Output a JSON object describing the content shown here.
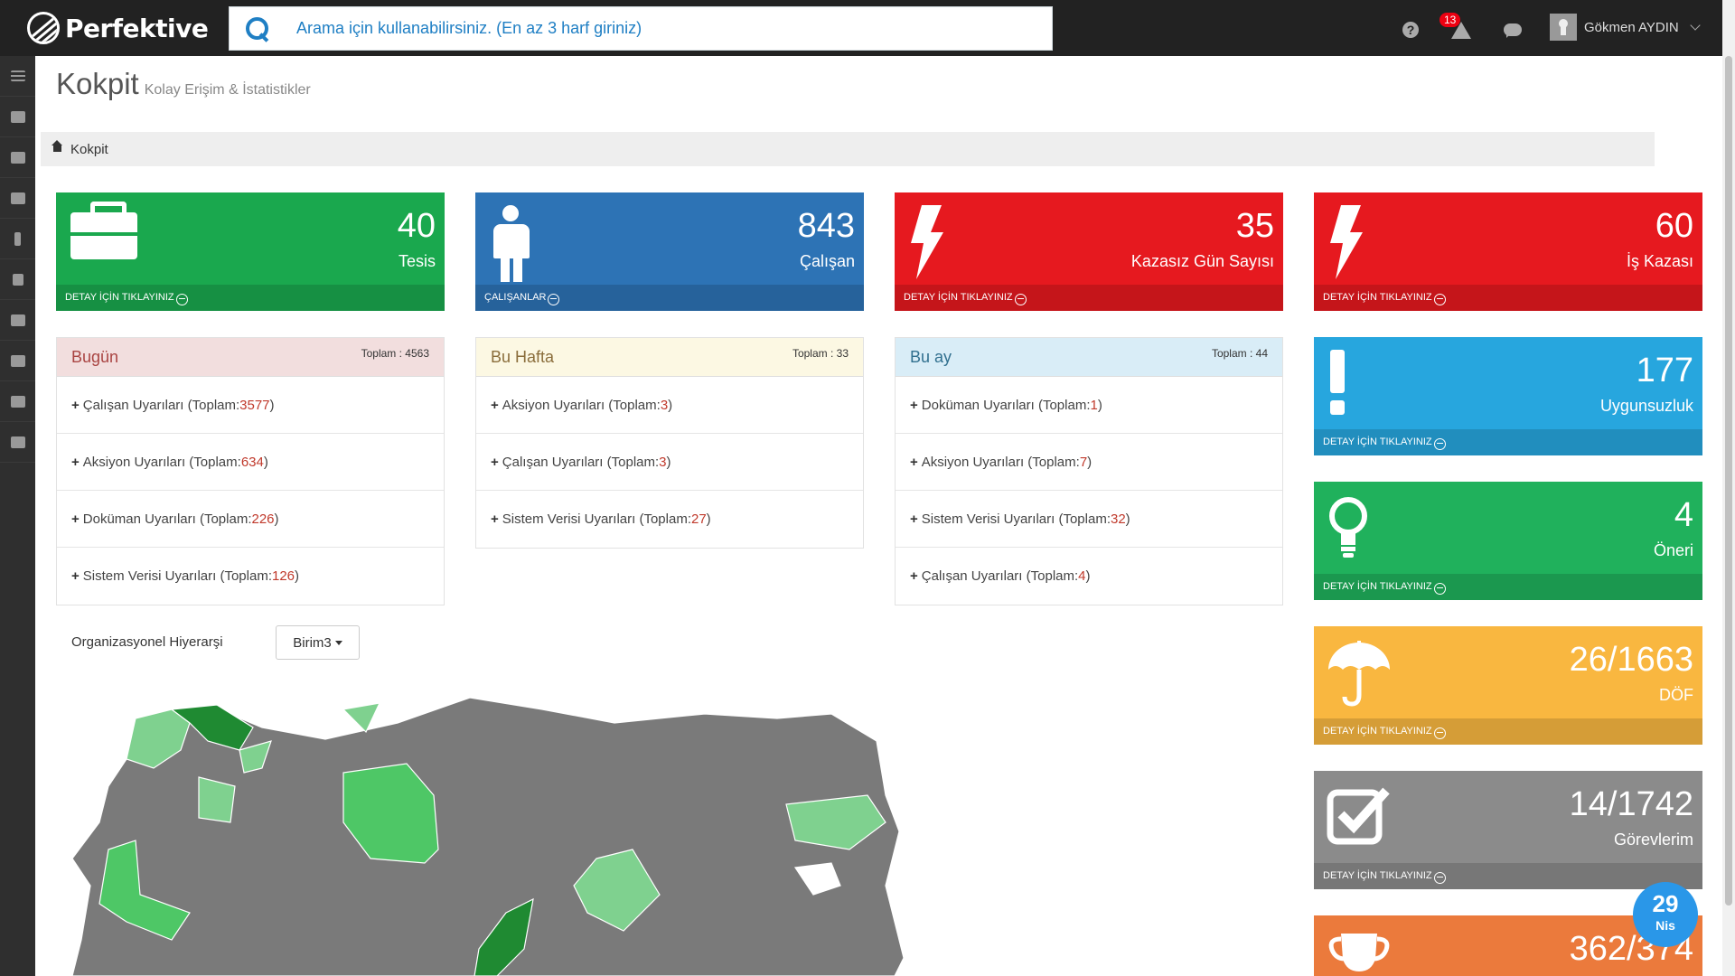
{
  "app": {
    "logo_text": "Perfektive"
  },
  "search": {
    "placeholder": "Arama için kullanabilirsiniz. (En az 3 harf giriniz)"
  },
  "topbar": {
    "alert_count": "13",
    "user_name": "Gökmen AYDIN"
  },
  "page": {
    "title": "Kokpit",
    "subtitle": "Kolay Erişim & İstatistikler",
    "breadcrumb": "Kokpit"
  },
  "stats": [
    {
      "value": "40",
      "label": "Tesis",
      "footer": "DETAY İÇİN TIKLAYINIZ",
      "icon": "briefcase-icon",
      "color": "#1aa84e"
    },
    {
      "value": "843",
      "label": "Çalışan",
      "footer": "ÇALIŞANLAR",
      "icon": "person-icon",
      "color": "#2d73b5"
    },
    {
      "value": "35",
      "label": "Kazasız Gün Sayısı",
      "footer": "DETAY İÇİN TIKLAYINIZ",
      "icon": "bolt-icon",
      "color": "#e6191f"
    },
    {
      "value": "60",
      "label": "İş Kazası",
      "footer": "DETAY İÇİN TIKLAYINIZ",
      "icon": "bolt-icon",
      "color": "#e6191f"
    }
  ],
  "side_stats": [
    {
      "value": "177",
      "label": "Uygunsuzluk",
      "footer": "DETAY İÇİN TIKLAYINIZ",
      "icon": "exclamation-icon",
      "color": "#27a6de"
    },
    {
      "value": "4",
      "label": "Öneri",
      "footer": "DETAY İÇİN TIKLAYINIZ",
      "icon": "lightbulb-icon",
      "color": "#20b15c"
    },
    {
      "value": "26/1663",
      "label": "DÖF",
      "footer": "DETAY İÇİN TIKLAYINIZ",
      "icon": "umbrella-icon",
      "color": "#f9b740"
    },
    {
      "value": "14/1742",
      "label": "Görevlerim",
      "footer": "DETAY İÇİN TIKLAYINIZ",
      "icon": "checkbox-icon",
      "color": "#8b8b8b"
    },
    {
      "value": "362/374",
      "label": "",
      "footer": "",
      "icon": "trophy-icon",
      "color": "#eb7a3c"
    }
  ],
  "panels": [
    {
      "title": "Bugün",
      "total": "Toplam : 4563",
      "items": [
        {
          "label": "Çalışan Uyarıları (Toplam: ",
          "count": "3577",
          "close": ")"
        },
        {
          "label": "Aksiyon Uyarıları (Toplam: ",
          "count": "634",
          "close": ")"
        },
        {
          "label": "Doküman Uyarıları (Toplam: ",
          "count": "226",
          "close": ")"
        },
        {
          "label": "Sistem Verisi Uyarıları (Toplam: ",
          "count": "126",
          "close": ")"
        }
      ]
    },
    {
      "title": "Bu Hafta",
      "total": "Toplam : 33",
      "items": [
        {
          "label": "Aksiyon Uyarıları (Toplam: ",
          "count": "3",
          "close": ")"
        },
        {
          "label": "Çalışan Uyarıları (Toplam: ",
          "count": "3",
          "close": ")"
        },
        {
          "label": "Sistem Verisi Uyarıları (Toplam: ",
          "count": "27",
          "close": ")"
        }
      ]
    },
    {
      "title": "Bu ay",
      "total": "Toplam : 44",
      "items": [
        {
          "label": "Doküman Uyarıları (Toplam: ",
          "count": "1",
          "close": ")"
        },
        {
          "label": "Aksiyon Uyarıları (Toplam: ",
          "count": "7",
          "close": ")"
        },
        {
          "label": "Sistem Verisi Uyarıları (Toplam: ",
          "count": "32",
          "close": ")"
        },
        {
          "label": "Çalışan Uyarıları (Toplam: ",
          "count": "4",
          "close": ")"
        }
      ]
    }
  ],
  "org": {
    "label": "Organizasyonel Hiyerarşi",
    "selected": "Birim3"
  },
  "date_badge": {
    "day": "29",
    "month": "Nis"
  },
  "colors": {
    "map_gray": "#7a7a7a",
    "map_light": "#7fd18f",
    "map_mid": "#4ec766",
    "map_dark": "#1f8a32"
  }
}
